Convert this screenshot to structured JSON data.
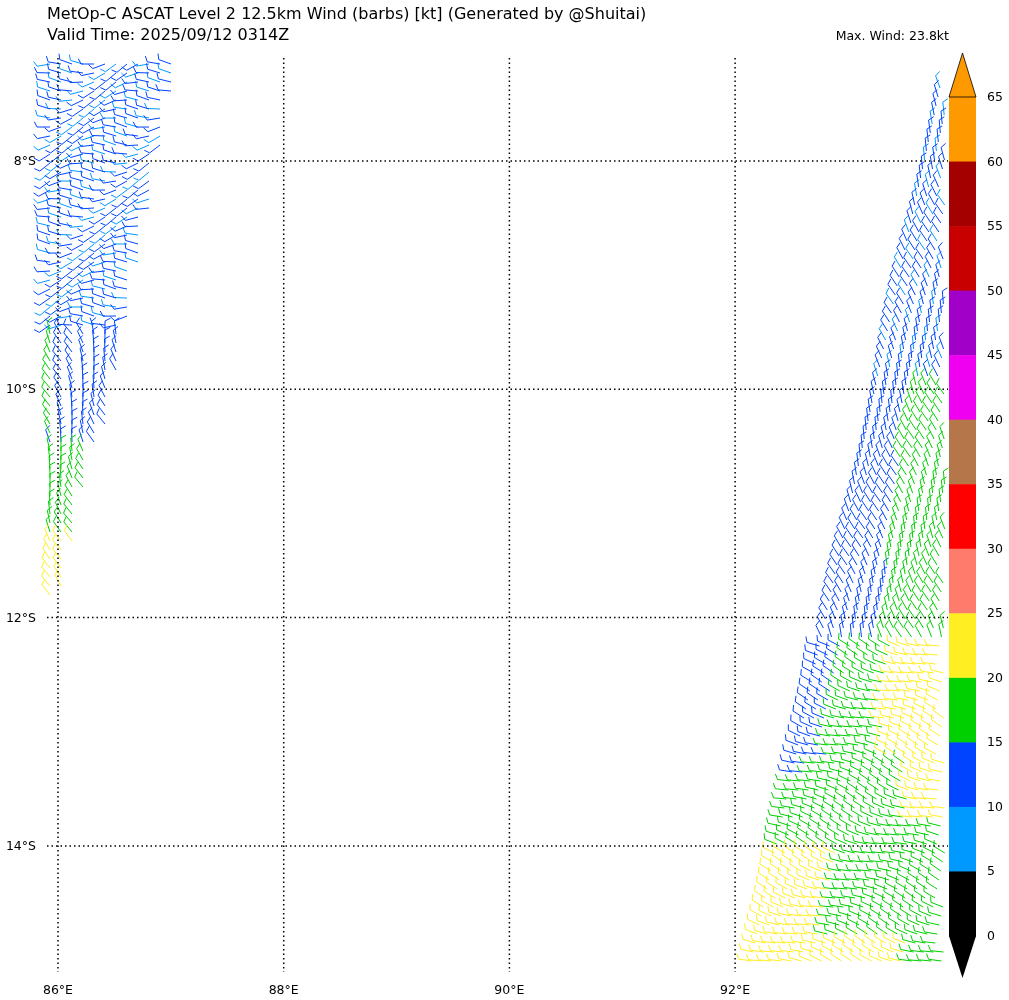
{
  "title": "MetOp-C ASCAT Level 2 12.5km Wind (barbs) [kt] (Generated by @Shuitai)",
  "valid_time": "Valid Time: 2025/09/12 0314Z",
  "max_wind": "Max. Wind: 23.8kt",
  "map": {
    "lat_labels": [
      "8°S",
      "10°S",
      "12°S",
      "14°S"
    ],
    "lon_labels": [
      "86°E",
      "88°E",
      "90°E",
      "92°E"
    ]
  },
  "colorbar": {
    "segments": [
      {
        "color": "#ff9900"
      },
      {
        "color": "#a50000"
      },
      {
        "color": "#c80000"
      },
      {
        "color": "#a000c8"
      },
      {
        "color": "#f000f0"
      },
      {
        "color": "#b5774a"
      },
      {
        "color": "#ff0000"
      },
      {
        "color": "#ff7b6b"
      },
      {
        "color": "#ffee22"
      },
      {
        "color": "#00d000"
      },
      {
        "color": "#0044ff"
      },
      {
        "color": "#0099ff"
      },
      {
        "color": "#000000"
      }
    ],
    "ticks": [
      "65",
      "60",
      "55",
      "50",
      "45",
      "40",
      "35",
      "30",
      "25",
      "20",
      "15",
      "10",
      "5",
      "0"
    ]
  }
}
